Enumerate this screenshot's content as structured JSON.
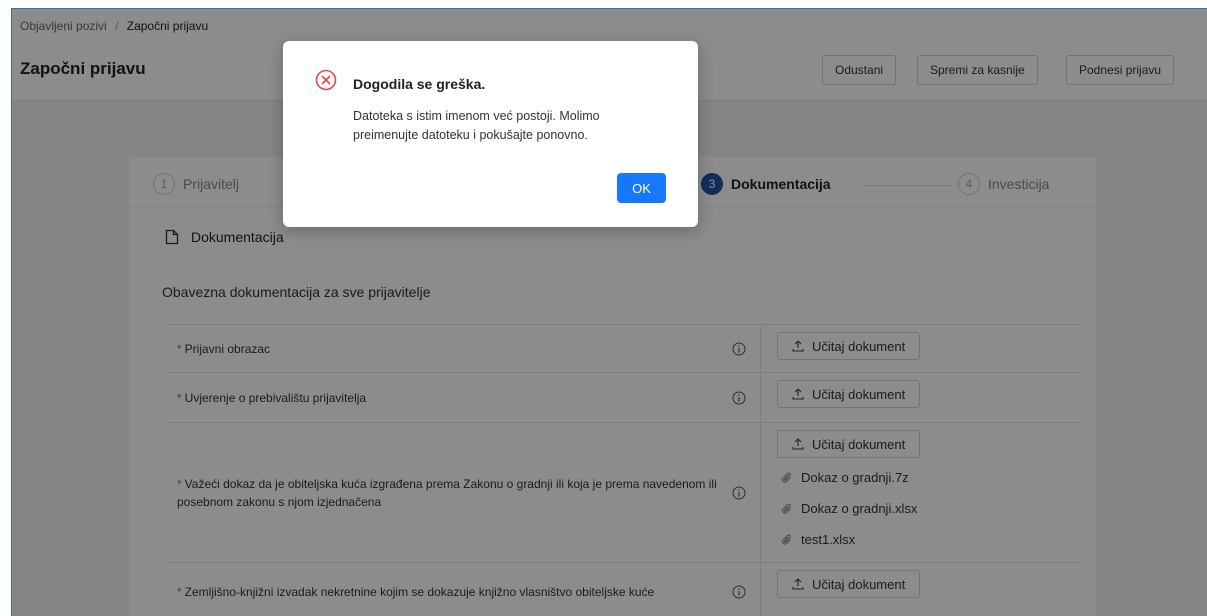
{
  "breadcrumb": {
    "parent": "Objavljeni pozivi",
    "separator": "/",
    "current": "Započni prijavu"
  },
  "page_title": "Započni prijavu",
  "header_buttons": {
    "cancel": "Odustani",
    "save_later": "Spremi za kasnije",
    "submit": "Podnesi prijavu"
  },
  "steps": [
    {
      "num": "1",
      "label": "Prijavitelj"
    },
    {
      "num": "3",
      "label": "Dokumentacija"
    },
    {
      "num": "4",
      "label": "Investicija"
    }
  ],
  "section": {
    "title": "Dokumentacija",
    "subtitle": "Obavezna dokumentacija za sve prijavitelje"
  },
  "required_mark": "*",
  "upload_label": "Učitaj dokument",
  "documents": [
    {
      "label": "Prijavni obrazac"
    },
    {
      "label": "Uvjerenje o prebivalištu prijavitelja"
    },
    {
      "label": "Važeći dokaz da je obiteljska kuća izgrađena prema Zakonu o gradnji ili koja je prema navedenom ili posebnom zakonu s njom izjednačena",
      "files": [
        "Dokaz o gradnji.7z",
        "Dokaz o gradnji.xlsx",
        "test1.xlsx"
      ]
    },
    {
      "label": "Zemljišno-knjižni izvadak nekretnine kojim se dokazuje knjižno vlasništvo obiteljske kuće"
    }
  ],
  "modal": {
    "title": "Dogodila se greška.",
    "message": "Datoteka s istim imenom već postoji. Molimo preimenujte datoteku i pokušajte ponovno.",
    "ok_label": "OK"
  },
  "colors": {
    "primary": "#1677ff",
    "step_active": "#1f55a6",
    "error": "#e8434a",
    "required": "#e04a3a"
  }
}
